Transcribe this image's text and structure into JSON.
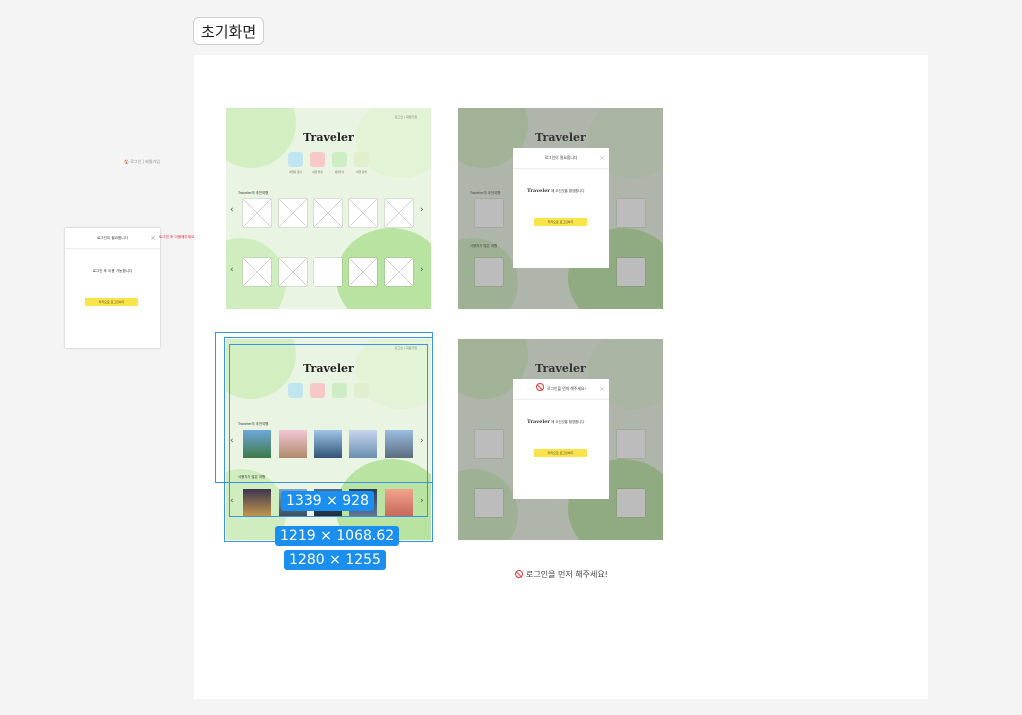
{
  "frame": {
    "label": "초기화면"
  },
  "standalone": {
    "top_nav": "🏠 로그인 | 회원가입",
    "modal_title": "로그인이 필요합니다",
    "modal_body": "로그인 후 이용 가능합니다",
    "kakao_label": "카카오로 로그인하기",
    "red_note": "로그인 후 이용해주세요"
  },
  "screen": {
    "logo": "Traveler",
    "top_nav": "로그인 | 회원가입",
    "categories": [
      "여행지 찾기",
      "여행 일정",
      "여행후기",
      "여행 검색"
    ],
    "section1": "Traveler의 추천여행",
    "section2": "사용자가 많은 여행",
    "arrow_left": "‹",
    "arrow_right": "›"
  },
  "popup1": {
    "title": "로그인이 필요합니다",
    "logo": "Traveler",
    "body": "에 오신것을 환영합니다",
    "kakao_label": "카카오로 로그인하기"
  },
  "popup2": {
    "title": "로그인을 먼저 해주세요!",
    "logo": "Traveler",
    "body": "에 오신것을 환영합니다",
    "kakao_label": "카카오로 로그인하기"
  },
  "measurements": {
    "a": "1339 × 928",
    "b": "1219 × 1068.62",
    "c": "1280 × 1255"
  },
  "bottom_note": "로그인을 먼저 해주세요!",
  "colors": {
    "accent": "#1b8ff0",
    "kakao": "#fbe44a",
    "canvas": "#ffffff",
    "bg": "#f4f4f4"
  }
}
